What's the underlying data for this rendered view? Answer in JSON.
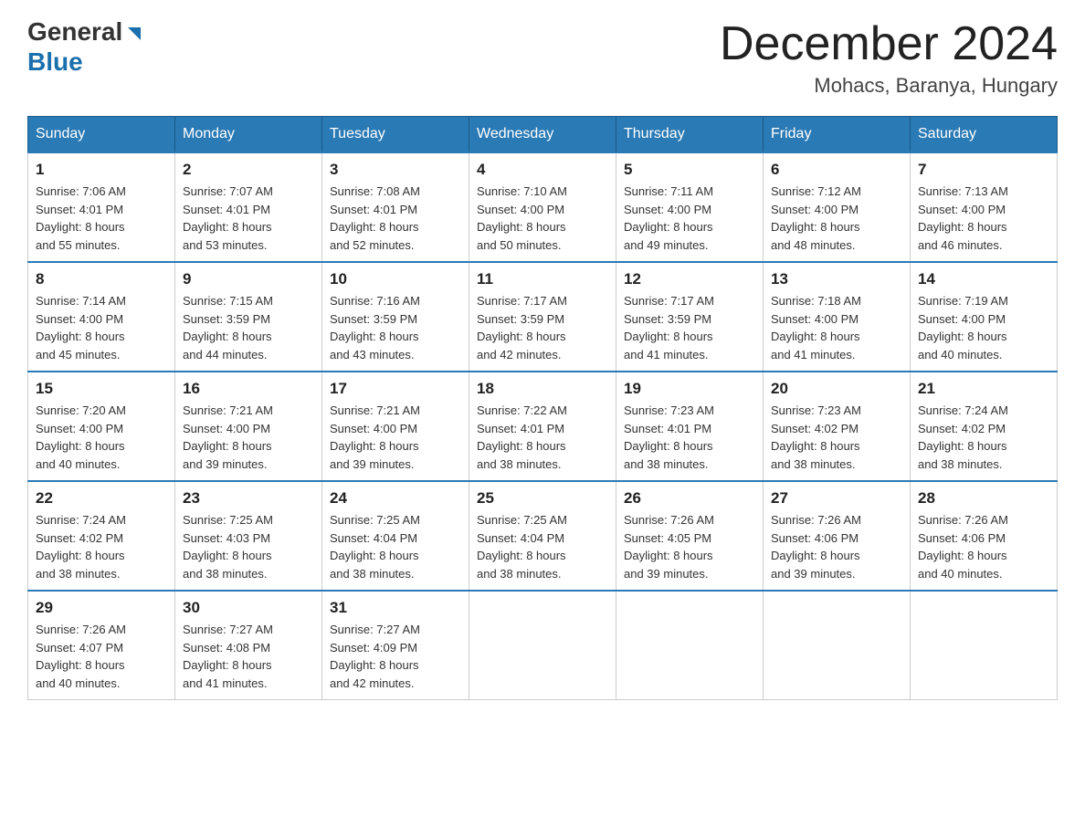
{
  "header": {
    "logo_general": "General",
    "logo_blue": "Blue",
    "month_title": "December 2024",
    "location": "Mohacs, Baranya, Hungary"
  },
  "days_of_week": [
    "Sunday",
    "Monday",
    "Tuesday",
    "Wednesday",
    "Thursday",
    "Friday",
    "Saturday"
  ],
  "weeks": [
    [
      {
        "day": "1",
        "sunrise": "7:06 AM",
        "sunset": "4:01 PM",
        "daylight": "8 hours and 55 minutes."
      },
      {
        "day": "2",
        "sunrise": "7:07 AM",
        "sunset": "4:01 PM",
        "daylight": "8 hours and 53 minutes."
      },
      {
        "day": "3",
        "sunrise": "7:08 AM",
        "sunset": "4:01 PM",
        "daylight": "8 hours and 52 minutes."
      },
      {
        "day": "4",
        "sunrise": "7:10 AM",
        "sunset": "4:00 PM",
        "daylight": "8 hours and 50 minutes."
      },
      {
        "day": "5",
        "sunrise": "7:11 AM",
        "sunset": "4:00 PM",
        "daylight": "8 hours and 49 minutes."
      },
      {
        "day": "6",
        "sunrise": "7:12 AM",
        "sunset": "4:00 PM",
        "daylight": "8 hours and 48 minutes."
      },
      {
        "day": "7",
        "sunrise": "7:13 AM",
        "sunset": "4:00 PM",
        "daylight": "8 hours and 46 minutes."
      }
    ],
    [
      {
        "day": "8",
        "sunrise": "7:14 AM",
        "sunset": "4:00 PM",
        "daylight": "8 hours and 45 minutes."
      },
      {
        "day": "9",
        "sunrise": "7:15 AM",
        "sunset": "3:59 PM",
        "daylight": "8 hours and 44 minutes."
      },
      {
        "day": "10",
        "sunrise": "7:16 AM",
        "sunset": "3:59 PM",
        "daylight": "8 hours and 43 minutes."
      },
      {
        "day": "11",
        "sunrise": "7:17 AM",
        "sunset": "3:59 PM",
        "daylight": "8 hours and 42 minutes."
      },
      {
        "day": "12",
        "sunrise": "7:17 AM",
        "sunset": "3:59 PM",
        "daylight": "8 hours and 41 minutes."
      },
      {
        "day": "13",
        "sunrise": "7:18 AM",
        "sunset": "4:00 PM",
        "daylight": "8 hours and 41 minutes."
      },
      {
        "day": "14",
        "sunrise": "7:19 AM",
        "sunset": "4:00 PM",
        "daylight": "8 hours and 40 minutes."
      }
    ],
    [
      {
        "day": "15",
        "sunrise": "7:20 AM",
        "sunset": "4:00 PM",
        "daylight": "8 hours and 40 minutes."
      },
      {
        "day": "16",
        "sunrise": "7:21 AM",
        "sunset": "4:00 PM",
        "daylight": "8 hours and 39 minutes."
      },
      {
        "day": "17",
        "sunrise": "7:21 AM",
        "sunset": "4:00 PM",
        "daylight": "8 hours and 39 minutes."
      },
      {
        "day": "18",
        "sunrise": "7:22 AM",
        "sunset": "4:01 PM",
        "daylight": "8 hours and 38 minutes."
      },
      {
        "day": "19",
        "sunrise": "7:23 AM",
        "sunset": "4:01 PM",
        "daylight": "8 hours and 38 minutes."
      },
      {
        "day": "20",
        "sunrise": "7:23 AM",
        "sunset": "4:02 PM",
        "daylight": "8 hours and 38 minutes."
      },
      {
        "day": "21",
        "sunrise": "7:24 AM",
        "sunset": "4:02 PM",
        "daylight": "8 hours and 38 minutes."
      }
    ],
    [
      {
        "day": "22",
        "sunrise": "7:24 AM",
        "sunset": "4:02 PM",
        "daylight": "8 hours and 38 minutes."
      },
      {
        "day": "23",
        "sunrise": "7:25 AM",
        "sunset": "4:03 PM",
        "daylight": "8 hours and 38 minutes."
      },
      {
        "day": "24",
        "sunrise": "7:25 AM",
        "sunset": "4:04 PM",
        "daylight": "8 hours and 38 minutes."
      },
      {
        "day": "25",
        "sunrise": "7:25 AM",
        "sunset": "4:04 PM",
        "daylight": "8 hours and 38 minutes."
      },
      {
        "day": "26",
        "sunrise": "7:26 AM",
        "sunset": "4:05 PM",
        "daylight": "8 hours and 39 minutes."
      },
      {
        "day": "27",
        "sunrise": "7:26 AM",
        "sunset": "4:06 PM",
        "daylight": "8 hours and 39 minutes."
      },
      {
        "day": "28",
        "sunrise": "7:26 AM",
        "sunset": "4:06 PM",
        "daylight": "8 hours and 40 minutes."
      }
    ],
    [
      {
        "day": "29",
        "sunrise": "7:26 AM",
        "sunset": "4:07 PM",
        "daylight": "8 hours and 40 minutes."
      },
      {
        "day": "30",
        "sunrise": "7:27 AM",
        "sunset": "4:08 PM",
        "daylight": "8 hours and 41 minutes."
      },
      {
        "day": "31",
        "sunrise": "7:27 AM",
        "sunset": "4:09 PM",
        "daylight": "8 hours and 42 minutes."
      },
      null,
      null,
      null,
      null
    ]
  ],
  "labels": {
    "sunrise": "Sunrise:",
    "sunset": "Sunset:",
    "daylight": "Daylight:"
  }
}
